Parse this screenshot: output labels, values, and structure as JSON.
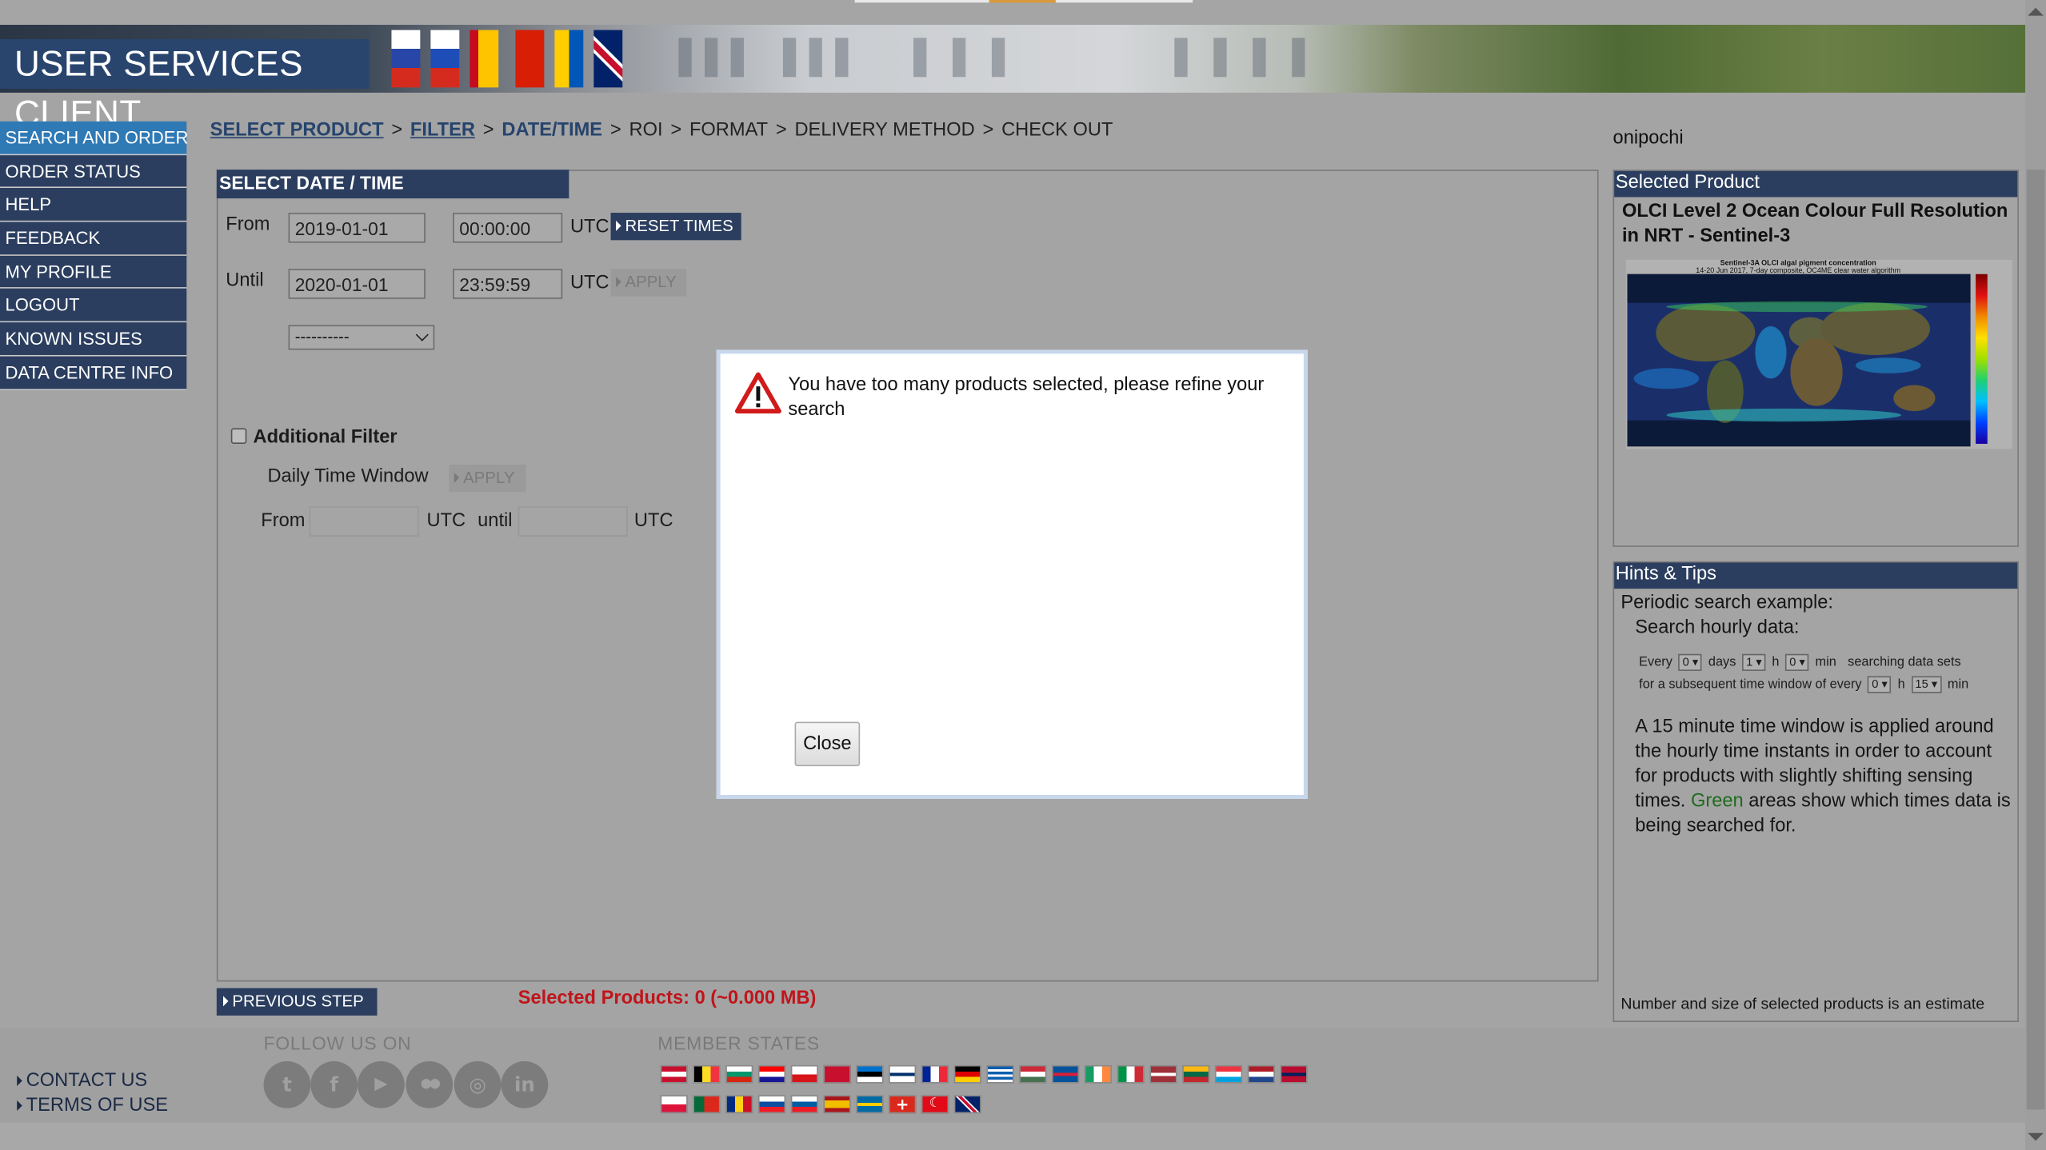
{
  "header": {
    "title": "USER SERVICES CLIENT"
  },
  "sidebar": {
    "items": [
      {
        "label": "SEARCH AND ORDER"
      },
      {
        "label": "ORDER STATUS"
      },
      {
        "label": "HELP"
      },
      {
        "label": "FEEDBACK"
      },
      {
        "label": "MY PROFILE"
      },
      {
        "label": "LOGOUT"
      },
      {
        "label": "KNOWN ISSUES"
      },
      {
        "label": "DATA CENTRE INFO"
      }
    ]
  },
  "breadcrumb": {
    "steps": [
      {
        "label": "SELECT PRODUCT"
      },
      {
        "label": "FILTER"
      },
      {
        "label": "DATE/TIME"
      },
      {
        "label": "ROI"
      },
      {
        "label": "FORMAT"
      },
      {
        "label": "DELIVERY METHOD"
      },
      {
        "label": "CHECK OUT"
      }
    ],
    "separator": ">"
  },
  "user": {
    "name": "onipochi"
  },
  "datetime": {
    "section_title": "SELECT DATE / TIME",
    "from_label": "From",
    "from_date": "2019-01-01",
    "from_time": "00:00:00",
    "until_label": "Until",
    "until_date": "2020-01-01",
    "until_time": "23:59:59",
    "utc": "UTC",
    "reset_label": "RESET TIMES",
    "apply_label": "APPLY",
    "preset_value": "----------"
  },
  "additional_filter": {
    "label": "Additional Filter",
    "daily_window_label": "Daily Time Window",
    "apply_label": "APPLY",
    "from_label": "From",
    "utc": "UTC",
    "until_label": "until"
  },
  "modal": {
    "message": "You have too many products selected, please refine your search",
    "close_label": "Close"
  },
  "bottom": {
    "previous_label": "PREVIOUS STEP",
    "selected_products": "Selected Products: 0 (~0.000 MB)"
  },
  "selected_product": {
    "header": "Selected Product",
    "title": "OLCI Level 2 Ocean Colour Full Resolution in NRT - Sentinel-3",
    "image_caption_line1": "Sentinel-3A OLCI algal pigment concentration",
    "image_caption_line2": "14-20 Jun 2017, 7-day composite, OC4ME clear water algorithm"
  },
  "hints": {
    "header": "Hints & Tips",
    "example_title": "Periodic search example:",
    "example_sub": "Search hourly data:",
    "row1": {
      "every": "Every",
      "days_val": "0",
      "days": "days",
      "h_val": "1",
      "h": "h",
      "min_val": "0",
      "min": "min",
      "tail": "searching data sets"
    },
    "row2": {
      "lead": "for a subsequent time window of every",
      "h_val": "0",
      "h": "h",
      "min_val": "15",
      "min": "min"
    },
    "para_part1": "A 15 minute time window is applied around the hourly time instants in order to account for products with slightly shifting sensing times.",
    "green_word": "Green",
    "para_part2": "areas show which times data is being searched for.",
    "footnote": "Number and size of selected products is an estimate",
    "green_color": "#1f6b1f"
  },
  "footer": {
    "links": [
      {
        "label": "CONTACT US"
      },
      {
        "label": "TERMS OF USE"
      }
    ],
    "follow_title": "FOLLOW US ON",
    "social": [
      {
        "icon": "twitter-icon",
        "glyph": "t"
      },
      {
        "icon": "facebook-icon",
        "glyph": "f"
      },
      {
        "icon": "youtube-icon",
        "glyph": "▶"
      },
      {
        "icon": "flickr-icon",
        "glyph": "●●"
      },
      {
        "icon": "instagram-icon",
        "glyph": "◎"
      },
      {
        "icon": "linkedin-icon",
        "glyph": "in"
      }
    ],
    "members_title": "MEMBER STATES"
  },
  "colors": {
    "nav_dark": "#2b3e5f",
    "nav_active": "#2f79b5",
    "alert_red": "#c0141a"
  }
}
